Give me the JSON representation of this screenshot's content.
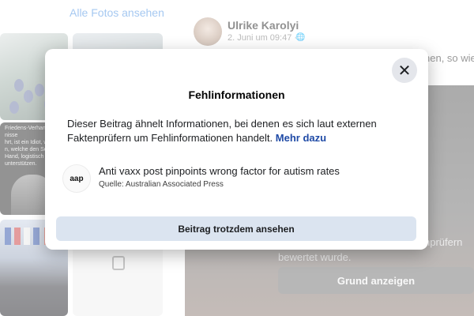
{
  "gallery": {
    "all_photos_link": "Alle Fotos ansehen",
    "news_caption": "Friedens-Verhandl\nnisse\nhrt, ist ein Idiot, wie\nn, welche den Selen\nHand, logistisch\nunterstützen."
  },
  "post": {
    "author": "Ulrike Karolyi",
    "date": "2. Juni um 09:47 ·",
    "audience_icon": "globe-icon",
    "text_fragment": "nen,  so wie"
  },
  "media_overlay": {
    "note": "deren Beitrag ist externen Faktenprüfern bewertet wurde.",
    "reason_button_label": "Grund anzeigen"
  },
  "modal": {
    "title": "Fehlinformationen",
    "close_icon": "close-icon",
    "body_text": "Dieser Beitrag ähnelt Informationen, bei denen es sich laut externen Faktenprüfern um Fehlinformationen handelt.",
    "more_link": "Mehr dazu",
    "fact_check": {
      "logo_text": "aap",
      "title": "Anti vaxx post pinpoints wrong factor for autism rates",
      "source": "Quelle: Australian Associated Press"
    },
    "view_button_label": "Beitrag trotzdem ansehen"
  },
  "colors": {
    "link_blue": "#1f4aa6",
    "button_bg": "#dbe4f0",
    "close_bg": "#e4e6eb"
  }
}
